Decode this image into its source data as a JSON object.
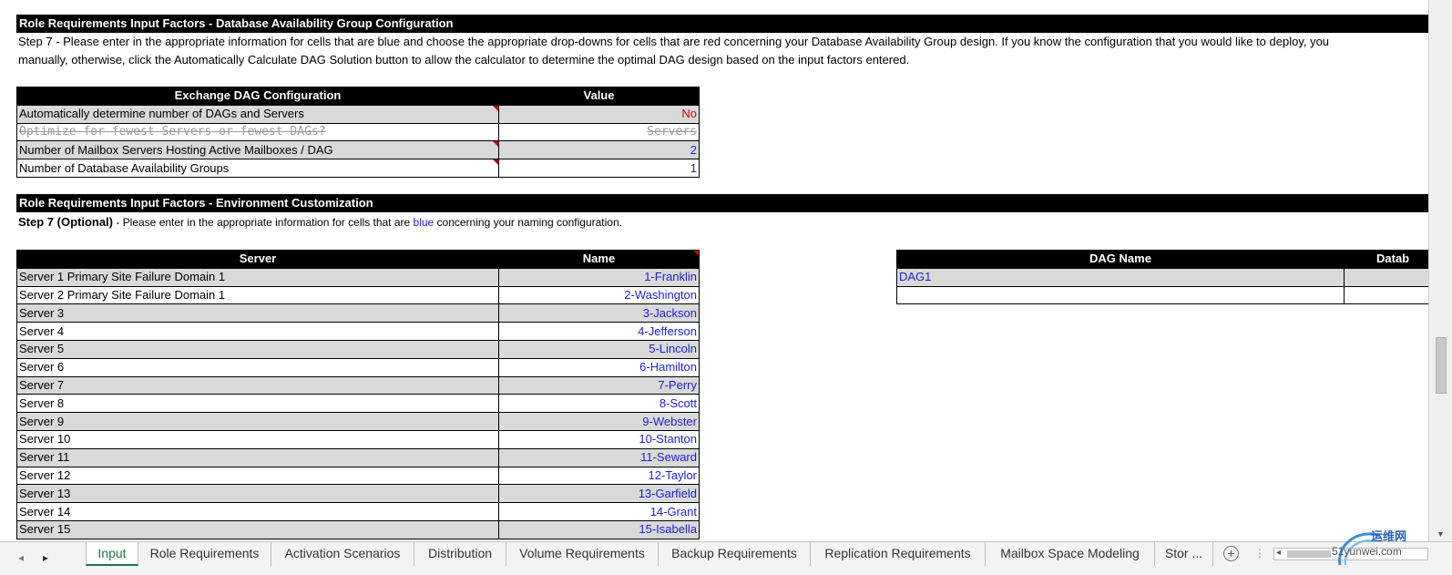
{
  "section1": {
    "title": "Role Requirements Input Factors - Database Availability Group Configuration",
    "step_line1": "Step 7 - Please enter in the appropriate information for cells that are blue and choose the appropriate drop-downs for cells that are red concerning your Database Availability Group design.  If you know the configuration that you would like to deploy, you",
    "step_line2": "manually, otherwise, click the Automatically Calculate DAG Solution button to allow the calculator to determine the optimal DAG design based on the input factors entered."
  },
  "dag_config": {
    "headers": [
      "Exchange DAG Configuration",
      "Value"
    ],
    "rows": [
      {
        "label": "Automatically determine number of DAGs and Servers",
        "value": "No"
      },
      {
        "label": "Optimize for fewest Servers or fewest DAGs?",
        "value": "Servers"
      },
      {
        "label": "Number of Mailbox Servers Hosting Active Mailboxes / DAG",
        "value": "2"
      },
      {
        "label": "Number of Database Availability Groups",
        "value": "1"
      }
    ]
  },
  "section2": {
    "title": "Role Requirements Input Factors - Environment Customization",
    "step_bold": "Step 7 (Optional)",
    "step_pre": " - Please enter in the appropriate information for cells that are ",
    "step_blue": "blue",
    "step_post": " concerning your naming configuration."
  },
  "servers": {
    "headers": [
      "Server",
      "Name"
    ],
    "rows": [
      {
        "server": "Server 1 Primary Site Failure Domain 1",
        "name": "1-Franklin"
      },
      {
        "server": "Server 2 Primary Site Failure Domain 1",
        "name": "2-Washington"
      },
      {
        "server": "Server 3",
        "name": "3-Jackson"
      },
      {
        "server": "Server 4",
        "name": "4-Jefferson"
      },
      {
        "server": "Server 5",
        "name": "5-Lincoln"
      },
      {
        "server": "Server 6",
        "name": "6-Hamilton"
      },
      {
        "server": "Server 7",
        "name": "7-Perry"
      },
      {
        "server": "Server 8",
        "name": "8-Scott"
      },
      {
        "server": "Server 9",
        "name": "9-Webster"
      },
      {
        "server": "Server 10",
        "name": "10-Stanton"
      },
      {
        "server": "Server 11",
        "name": "11-Seward"
      },
      {
        "server": "Server 12",
        "name": "12-Taylor"
      },
      {
        "server": "Server 13",
        "name": "13-Garfield"
      },
      {
        "server": "Server 14",
        "name": "14-Grant"
      },
      {
        "server": "Server 15",
        "name": "15-Isabella"
      }
    ]
  },
  "dag_names": {
    "headers": [
      "DAG Name",
      "Datab"
    ],
    "rows": [
      {
        "name": "DAG1",
        "db": ""
      },
      {
        "name": "",
        "db": ""
      }
    ]
  },
  "tabs": [
    "Input",
    "Role Requirements",
    "Activation Scenarios",
    "Distribution",
    "Volume Requirements",
    "Backup Requirements",
    "Replication Requirements",
    "Mailbox Space Modeling",
    "Stor ..."
  ],
  "watermark": {
    "brand": "运维网",
    "sub": "51yunwei.com"
  },
  "colors": {
    "header_bg": "#000000",
    "shade_row": "#d9d9d9",
    "input_blue": "#1f1fd8",
    "dropdown_red": "#e00000",
    "tab_active": "#217346"
  }
}
